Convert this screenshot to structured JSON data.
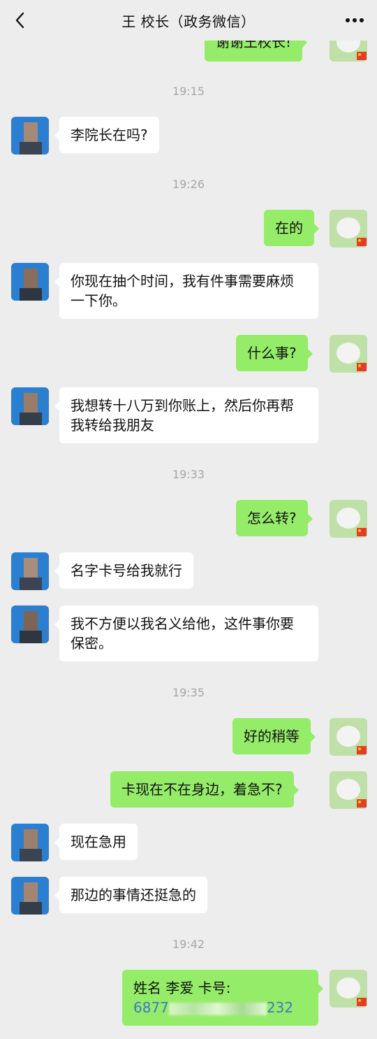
{
  "header": {
    "title": "王 校长（政务微信）",
    "back_icon": "back-arrow-icon",
    "more_icon": "more-dots-icon"
  },
  "colors": {
    "background": "#ededed",
    "sent_bubble": "#95ec69",
    "received_bubble": "#ffffff",
    "timestamp": "#a6a6a6",
    "link_text": "#3f79c9"
  },
  "messages": [
    {
      "type": "sent",
      "text": "谢谢王校长!"
    },
    {
      "type": "time",
      "text": "19:15"
    },
    {
      "type": "received",
      "text": "李院长在吗?"
    },
    {
      "type": "time",
      "text": "19:26"
    },
    {
      "type": "sent",
      "text": "在的"
    },
    {
      "type": "received",
      "text": "你现在抽个时间，我有件事需要麻烦一下你。"
    },
    {
      "type": "sent",
      "text": "什么事?"
    },
    {
      "type": "received",
      "text": "我想转十八万到你账上，然后你再帮我转给我朋友"
    },
    {
      "type": "time",
      "text": "19:33"
    },
    {
      "type": "sent",
      "text": "怎么转?"
    },
    {
      "type": "received",
      "text": "名字卡号给我就行"
    },
    {
      "type": "received",
      "text": "我不方便以我名义给他，这件事你要保密。"
    },
    {
      "type": "time",
      "text": "19:35"
    },
    {
      "type": "sent",
      "text": "好的稍等"
    },
    {
      "type": "sent",
      "text": "卡现在不在身边，着急不?"
    },
    {
      "type": "received",
      "text": "现在急用"
    },
    {
      "type": "received",
      "text": "那边的事情还挺急的"
    },
    {
      "type": "time",
      "text": "19:42"
    },
    {
      "type": "sent",
      "line1": "姓名 李爱  卡号:",
      "line2_start": "6877",
      "line2_end": "232"
    }
  ]
}
